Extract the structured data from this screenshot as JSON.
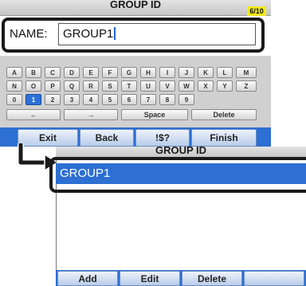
{
  "screen1": {
    "title": "GROUP ID",
    "counter": "6/10",
    "name_label": "NAME:",
    "name_value": "GROUP1",
    "keyboard": {
      "row1": [
        "A",
        "B",
        "C",
        "D",
        "E",
        "F",
        "G",
        "H",
        "I",
        "J",
        "K",
        "L",
        "M"
      ],
      "row2": [
        "N",
        "O",
        "P",
        "Q",
        "R",
        "S",
        "T",
        "U",
        "V",
        "W",
        "X",
        "Y",
        "Z"
      ],
      "row3": [
        "0",
        "1",
        "2",
        "3",
        "4",
        "5",
        "6",
        "7",
        "8",
        "9"
      ],
      "row4": [
        "←",
        "→",
        "Space",
        "Delete"
      ],
      "selected_key": "1"
    },
    "softkeys": [
      "Exit",
      "Back",
      "!$?",
      "Finish"
    ]
  },
  "screen2": {
    "title": "GROUP ID",
    "items": [
      "GROUP1"
    ],
    "softkeys": [
      "Add",
      "Edit",
      "Delete"
    ]
  },
  "colors": {
    "accent_blue": "#2d6fd2",
    "counter_yellow": "#f4ea1c",
    "callout_black": "#1a1a1a"
  }
}
